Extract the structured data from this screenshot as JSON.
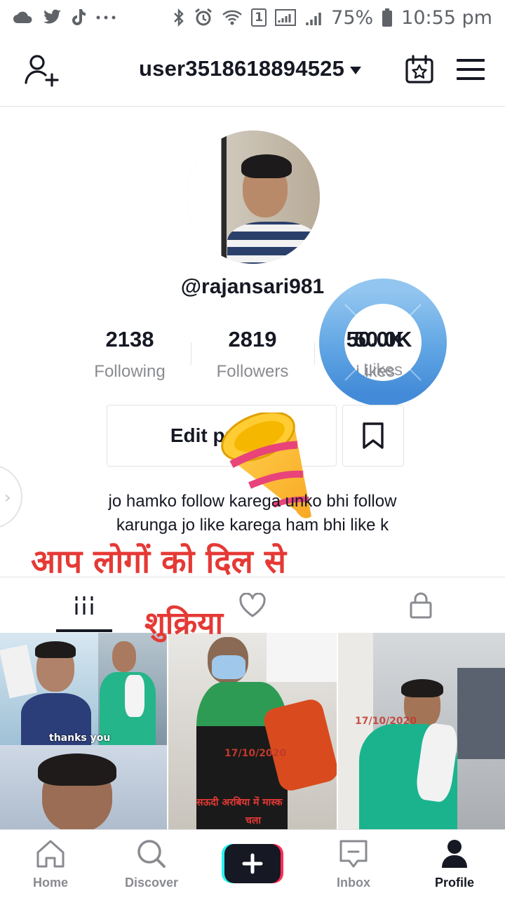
{
  "status_bar": {
    "left_icons": [
      "cloud-icon",
      "twitter-icon",
      "tiktok-icon",
      "more-dots-icon"
    ],
    "sim_badge": "1",
    "battery": "75%",
    "time": "10:55 pm"
  },
  "header": {
    "username": "user3518618894525"
  },
  "profile": {
    "handle": "@rajansari981",
    "stats": [
      {
        "value": "2138",
        "label": "Following"
      },
      {
        "value": "2819",
        "label": "Followers"
      },
      {
        "value": "50.0K",
        "label": "Likes"
      }
    ],
    "edit_label": "Edit profile",
    "bio_line1": "jo hamko follow karega unko bhi follow",
    "bio_line2": "karunga jo like karega ham bhi like k"
  },
  "overlay": {
    "line1": "आप लोगों को दिल से",
    "line2": "शुक्रिया"
  },
  "videos": [
    {
      "caption": "thanks you"
    },
    {
      "caption": ""
    },
    {
      "date": "17/10/2020",
      "caption_line1": "सऊदी अरबिया में मास्क",
      "caption_line2": "चला"
    },
    {
      "date": "17/10/2020"
    }
  ],
  "bottom_nav": {
    "items": [
      {
        "label": "Home"
      },
      {
        "label": "Discover"
      },
      {
        "label": "Inbox"
      },
      {
        "label": "Profile"
      }
    ]
  },
  "colors": {
    "accent_red": "#e53935",
    "text_primary": "#161823",
    "text_secondary": "#8a8b91",
    "tiktok_cyan": "#25f4ee",
    "tiktok_pink": "#fe2c55",
    "donut_blue": "#4a90d9"
  }
}
